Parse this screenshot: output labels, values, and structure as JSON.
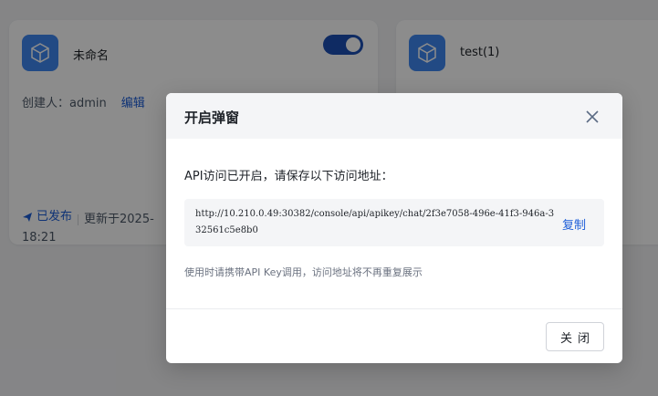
{
  "cards": [
    {
      "title": "未命名",
      "creator": "创建人：admin",
      "edit_label": "编辑",
      "status": "已发布",
      "updated": "更新于2025-",
      "time": "18:21",
      "toggle_on": true
    },
    {
      "title": "test(1)"
    }
  ],
  "modal": {
    "title": "开启弹窗",
    "message": "API访问已开启，请保存以下访问地址：",
    "url": "http://10.210.0.49:30382/console/api/apikey/chat/2f3e7058-496e-41f3-946a-332561c5e8b0",
    "copy_label": "复制",
    "hint": "使用时请携带API Key调用，访问地址将不再重复展示",
    "close_button": "关闭"
  },
  "colors": {
    "accent": "#1d5ed8",
    "toggle_bg": "#1d4fb5",
    "app_icon_bg": "#3f88f1"
  },
  "icons": {
    "app_icon": "cube-icon",
    "close": "close-icon",
    "published": "send-icon"
  }
}
